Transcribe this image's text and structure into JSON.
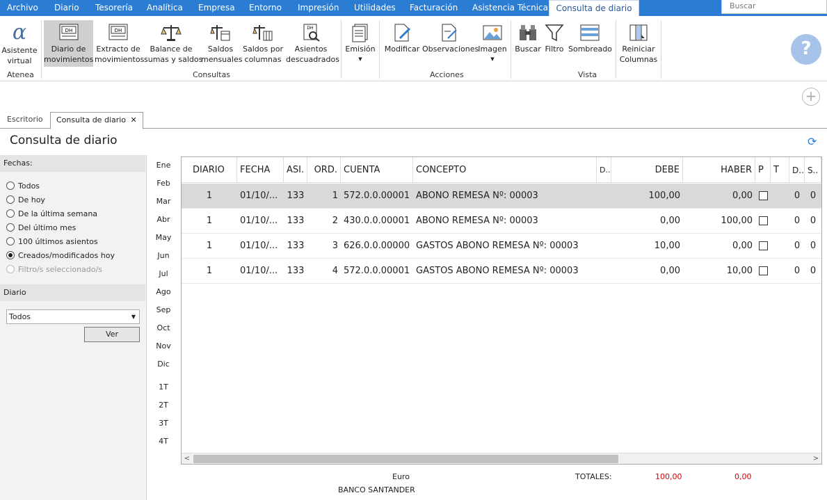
{
  "menu": {
    "items": [
      "Archivo",
      "Diario",
      "Tesorería",
      "Analítica",
      "Empresa",
      "Entorno",
      "Impresión",
      "Utilidades",
      "Facturación",
      "Asistencia Técnica"
    ],
    "active": "Consulta de diario",
    "search_placeholder": "Buscar"
  },
  "ribbon": {
    "atenea": {
      "label": "Atenea",
      "asistente": [
        "Asistente",
        "virtual"
      ]
    },
    "consultas": {
      "label": "Consultas",
      "buttons": [
        [
          "Diario de",
          "movimientos"
        ],
        [
          "Extracto de",
          "movimientos"
        ],
        [
          "Balance de",
          "sumas y saldos"
        ],
        [
          "Saldos",
          "mensuales"
        ],
        [
          "Saldos por",
          "columnas"
        ],
        [
          "Asientos",
          "descuadrados"
        ]
      ],
      "emision": "Emisión"
    },
    "acciones": {
      "label": "Acciones",
      "buttons": [
        "Modificar",
        "Observaciones",
        "Imagen"
      ]
    },
    "vista": {
      "label": "Vista",
      "buttons": [
        "Buscar",
        "Filtro",
        "Sombreado"
      ],
      "reiniciar": [
        "Reiniciar",
        "Columnas"
      ]
    },
    "help_icon": "question-circle-icon"
  },
  "tabs": {
    "escritorio": "Escritorio",
    "consulta": "Consulta de diario",
    "close": "✕"
  },
  "page_title": "Consulta de diario",
  "filters": {
    "fechas_label": "Fechas:",
    "options": [
      "Todos",
      "De hoy",
      "De la última semana",
      "Del último mes",
      "100 últimos asientos",
      "Creados/modificados hoy",
      "Filtro/s seleccionado/s"
    ],
    "selected": "Creados/modificados hoy",
    "diario_label": "Diario",
    "diario_value": "Todos",
    "ver_label": "Ver"
  },
  "months": [
    "Ene",
    "Feb",
    "Mar",
    "Abr",
    "May",
    "Jun",
    "Jul",
    "Ago",
    "Sep",
    "Oct",
    "Nov",
    "Dic"
  ],
  "quarters": [
    "1T",
    "2T",
    "3T",
    "4T"
  ],
  "table": {
    "columns": [
      "DIARIO",
      "FECHA",
      "ASI.",
      "ORD.",
      "CUENTA",
      "CONCEPTO",
      "D..",
      "DEBE",
      "HABER",
      "P",
      "T",
      "D..",
      "S.."
    ],
    "rows": [
      {
        "diario": "1",
        "fecha": "01/10/...",
        "asi": "133",
        "ord": "1",
        "cuenta": "572.0.0.00001",
        "concepto": "ABONO REMESA Nº: 00003",
        "debe": "100,00",
        "haber": "0,00",
        "t": "0",
        "s": "0"
      },
      {
        "diario": "1",
        "fecha": "01/10/...",
        "asi": "133",
        "ord": "2",
        "cuenta": "430.0.0.00001",
        "concepto": "ABONO REMESA Nº: 00003",
        "debe": "0,00",
        "haber": "100,00",
        "t": "0",
        "s": "0"
      },
      {
        "diario": "1",
        "fecha": "01/10/...",
        "asi": "133",
        "ord": "3",
        "cuenta": "626.0.0.00000",
        "concepto": "GASTOS ABONO REMESA Nº: 00003",
        "debe": "10,00",
        "haber": "0,00",
        "t": "0",
        "s": "0"
      },
      {
        "diario": "1",
        "fecha": "01/10/...",
        "asi": "133",
        "ord": "4",
        "cuenta": "572.0.0.00001",
        "concepto": "GASTOS ABONO REMESA Nº: 00003",
        "debe": "0,00",
        "haber": "10,00",
        "t": "0",
        "s": "0"
      }
    ]
  },
  "footer": {
    "currency": "Euro",
    "bank": "BANCO SANTANDER",
    "totales_label": "TOTALES:",
    "total_debe": "100,00",
    "total_haber": "0,00"
  },
  "colors": {
    "accent": "#2b7cd3",
    "totals": "#e00000"
  }
}
